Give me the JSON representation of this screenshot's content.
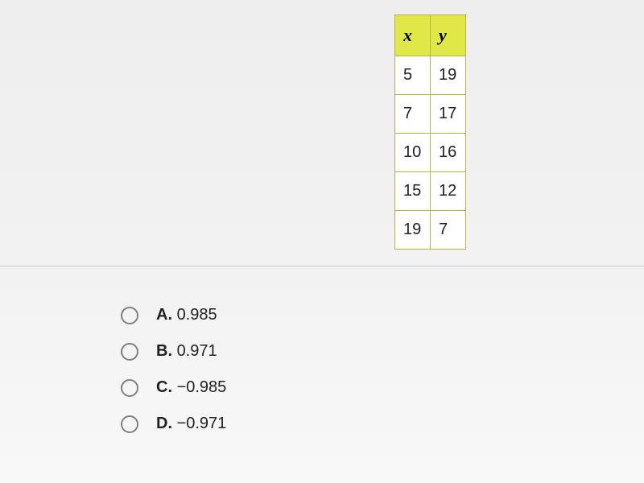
{
  "table": {
    "headers": [
      "x",
      "y"
    ],
    "rows": [
      {
        "x": "5",
        "y": "19"
      },
      {
        "x": "7",
        "y": "17"
      },
      {
        "x": "10",
        "y": "16"
      },
      {
        "x": "15",
        "y": "12"
      },
      {
        "x": "19",
        "y": "7"
      }
    ]
  },
  "options": [
    {
      "letter": "A.",
      "value": "0.985"
    },
    {
      "letter": "B.",
      "value": "0.971"
    },
    {
      "letter": "C.",
      "value": "−0.985"
    },
    {
      "letter": "D.",
      "value": "−0.971"
    }
  ]
}
